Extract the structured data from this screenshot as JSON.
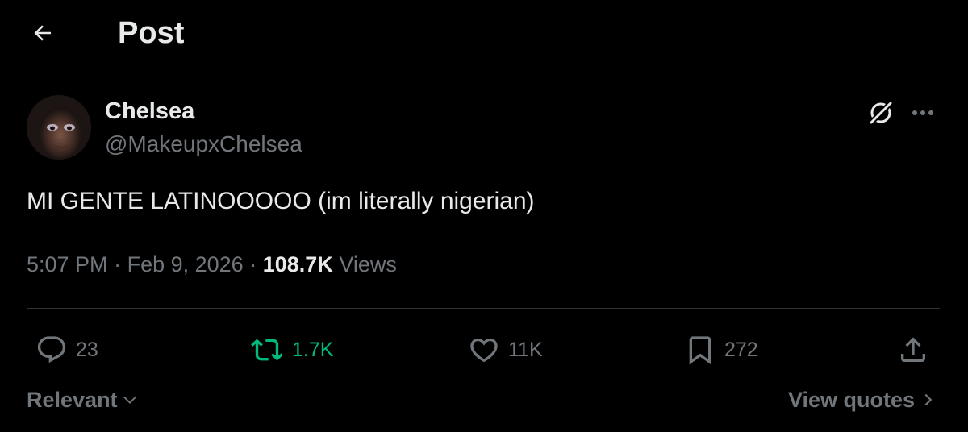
{
  "header": {
    "title": "Post",
    "back_icon": "arrow-left-icon"
  },
  "author": {
    "display_name": "Chelsea",
    "handle": "@MakeupxChelsea",
    "avatar_alt": "avatar"
  },
  "post": {
    "text": "MI GENTE LATINOOOOO (im literally nigerian)",
    "time": "5:07 PM",
    "date": "Feb 9, 2026",
    "views_count": "108.7K",
    "views_label": "Views"
  },
  "actions": {
    "replies": "23",
    "reposts": "1.7K",
    "likes": "11K",
    "bookmarks": "272"
  },
  "footer": {
    "sort_label": "Relevant",
    "view_quotes_label": "View quotes"
  },
  "colors": {
    "background": "#000000",
    "text_primary": "#e7e9ea",
    "text_secondary": "#71767b",
    "repost_active": "#00ba7c",
    "divider": "#2f3336"
  }
}
